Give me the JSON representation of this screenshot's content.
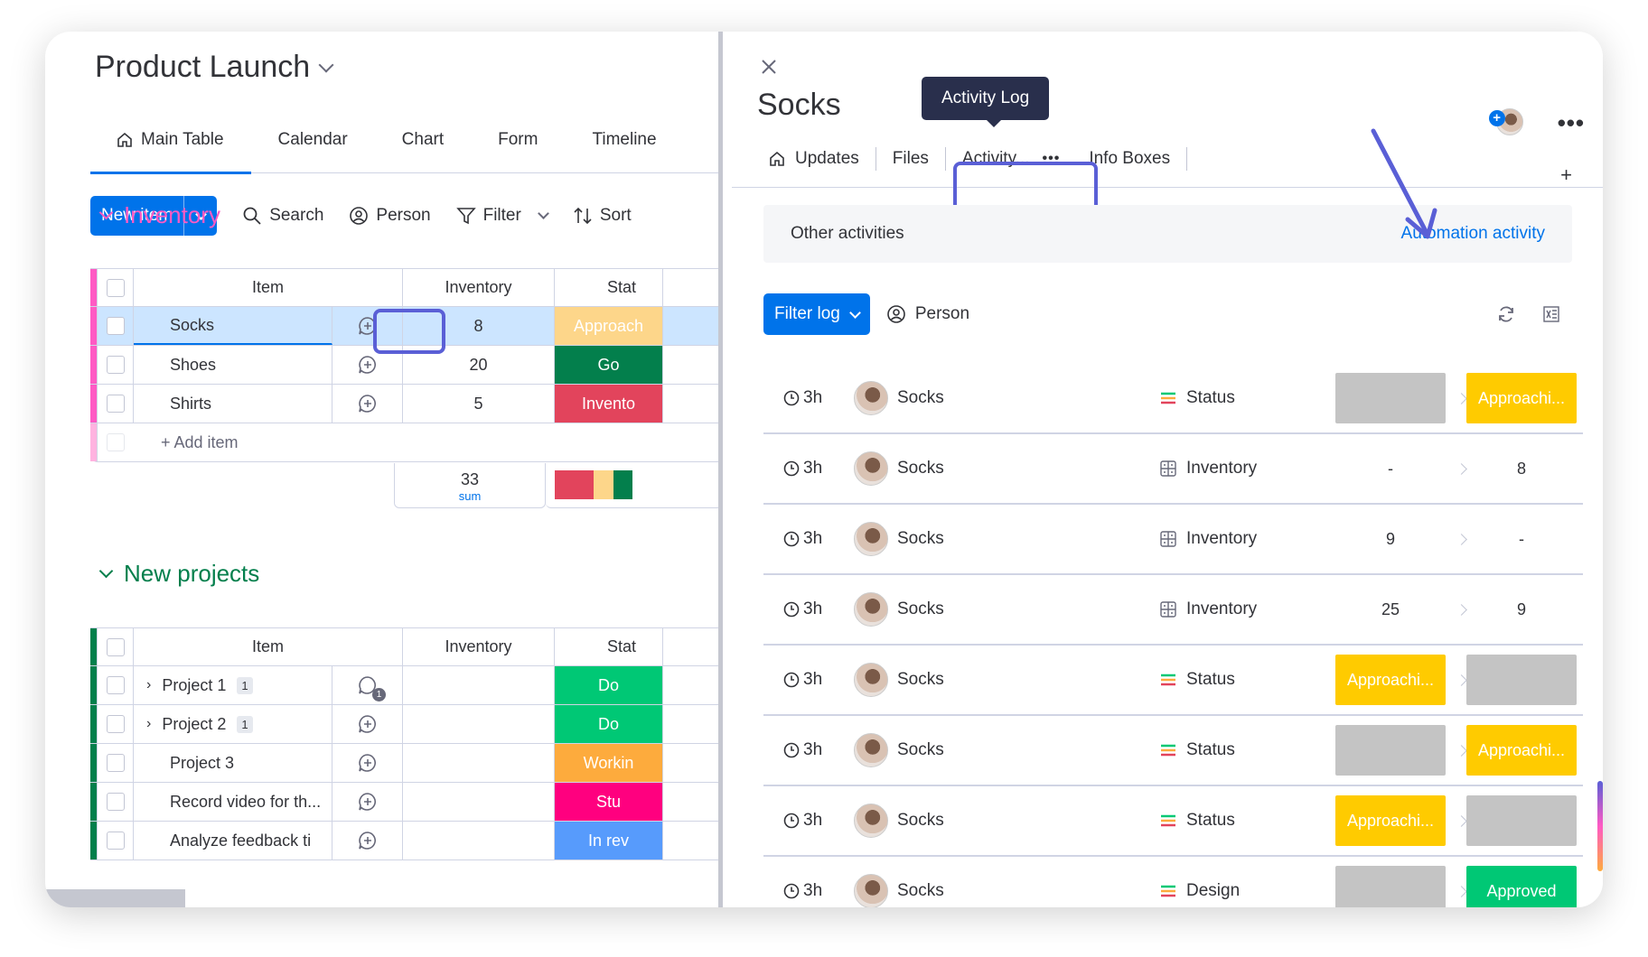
{
  "board": {
    "title": "Product Launch",
    "tabs": [
      {
        "label": "Main Table",
        "active": true
      },
      {
        "label": "Calendar"
      },
      {
        "label": "Chart"
      },
      {
        "label": "Form"
      },
      {
        "label": "Timeline"
      }
    ],
    "toolbar": {
      "new_item": "New item",
      "search": "Search",
      "person": "Person",
      "filter": "Filter",
      "sort": "Sort"
    },
    "groups": [
      {
        "name": "Inventory",
        "color": "#ff5ac4",
        "headers": {
          "item": "Item",
          "inventory": "Inventory",
          "status": "Stat"
        },
        "rows": [
          {
            "item": "Socks",
            "inventory": "8",
            "status": "Approach",
            "status_color": "#fdd68a"
          },
          {
            "item": "Shoes",
            "inventory": "20",
            "status": "Go",
            "status_color": "#037f4c"
          },
          {
            "item": "Shirts",
            "inventory": "5",
            "status": "Invento",
            "status_color": "#e2445c"
          }
        ],
        "add_item": "+ Add item",
        "sum_value": "33",
        "sum_label": "sum"
      },
      {
        "name": "New projects",
        "color": "#037f4c",
        "headers": {
          "item": "Item",
          "inventory": "Inventory",
          "status": "Stat"
        },
        "rows": [
          {
            "item": "Project 1",
            "badge": "1",
            "status": "Do",
            "status_color": "#00c875",
            "conv_count": "1"
          },
          {
            "item": "Project 2",
            "badge": "1",
            "status": "Do",
            "status_color": "#00c875"
          },
          {
            "item": "Project 3",
            "status": "Workin",
            "status_color": "#fdab3d"
          },
          {
            "item": "Record video for th...",
            "status": "Stu",
            "status_color": "#ff007f"
          },
          {
            "item": "Analyze feedback ti",
            "status": "In rev",
            "status_color": "#579bfc"
          }
        ]
      }
    ]
  },
  "panel": {
    "item_name": "Socks",
    "tooltip": "Activity Log",
    "tabs": [
      "Updates",
      "Files",
      "Activity...",
      "Info Boxes"
    ],
    "tab_plus": "+",
    "more": "•••",
    "other_activities": "Other activities",
    "automation_activity": "Automation activity",
    "filter_log": "Filter log",
    "person": "Person",
    "log": [
      {
        "time": "3h",
        "who": "Socks",
        "column": "Status",
        "col_icon": "status",
        "from": "",
        "from_color": "#c4c4c4",
        "to": "Approachi...",
        "to_color": "#ffcb00"
      },
      {
        "time": "3h",
        "who": "Socks",
        "column": "Inventory",
        "col_icon": "numbers",
        "from": "-",
        "from_color": "",
        "to": "8",
        "to_color": ""
      },
      {
        "time": "3h",
        "who": "Socks",
        "column": "Inventory",
        "col_icon": "numbers",
        "from": "9",
        "from_color": "",
        "to": "-",
        "to_color": ""
      },
      {
        "time": "3h",
        "who": "Socks",
        "column": "Inventory",
        "col_icon": "numbers",
        "from": "25",
        "from_color": "",
        "to": "9",
        "to_color": ""
      },
      {
        "time": "3h",
        "who": "Socks",
        "column": "Status",
        "col_icon": "status",
        "from": "Approachi...",
        "from_color": "#ffcb00",
        "to": "",
        "to_color": "#c4c4c4"
      },
      {
        "time": "3h",
        "who": "Socks",
        "column": "Status",
        "col_icon": "status",
        "from": "",
        "from_color": "#c4c4c4",
        "to": "Approachi...",
        "to_color": "#ffcb00"
      },
      {
        "time": "3h",
        "who": "Socks",
        "column": "Status",
        "col_icon": "status",
        "from": "Approachi...",
        "from_color": "#ffcb00",
        "to": "",
        "to_color": "#c4c4c4"
      },
      {
        "time": "3h",
        "who": "Socks",
        "column": "Design",
        "col_icon": "status",
        "from": "",
        "from_color": "#c4c4c4",
        "to": "Approved",
        "to_color": "#00c875"
      }
    ]
  },
  "colors": {
    "primary": "#0073ea",
    "highlight": "#5a5fd6",
    "tooltip_bg": "#292f4c"
  }
}
